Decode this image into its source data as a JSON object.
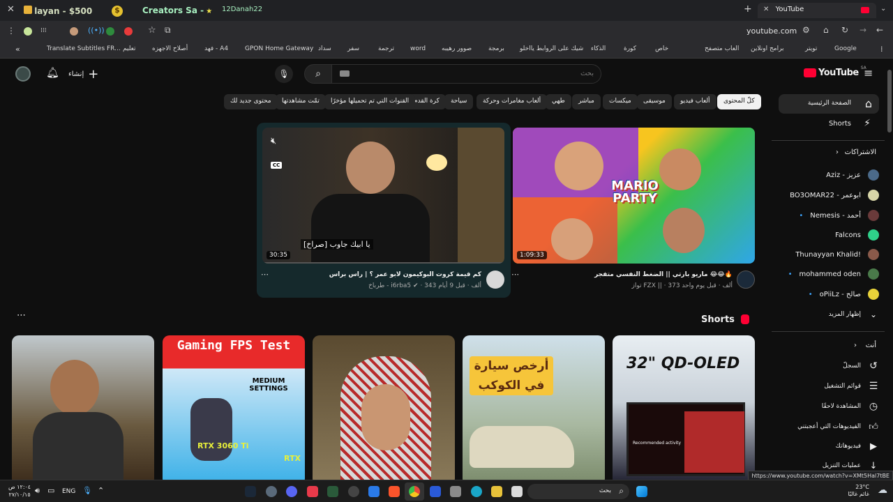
{
  "browser": {
    "tabs": [
      {
        "label": "layan - $500"
      },
      {
        "label": "Creators Sa -"
      },
      {
        "label": "12Danah22"
      }
    ],
    "active_tab": "YouTube",
    "url": "youtube.com",
    "bookmarks": [
      "Google",
      "تويتر",
      "برامج اونلاين",
      "العاب متصفح",
      "خاص",
      "كورة",
      "الذكاء",
      "شيك على الروابط يااخلو",
      "برمجة",
      "صوور رهيبه",
      "word",
      "ترجمة",
      "سفر",
      "سداد",
      "GPON Home Gateway",
      "فهد - A4",
      "أصلاح الاجهزه",
      "تعليم",
      "Translate Subtitles FR..."
    ]
  },
  "youtube": {
    "logo": "YouTube",
    "region": "SA",
    "search_placeholder": "بحث",
    "create_label": "إنشاء",
    "chips": [
      "كلّ المحتوى",
      "ألعاب فيديو",
      "موسيقى",
      "ميكسات",
      "مباشر",
      "طهي",
      "ألعاب مغامرات وحركة",
      "سياحة",
      "كرة القدم",
      "القنوات التي تم تحميلها مؤخرًا",
      "تمّت مشاهدتها",
      "محتوى جديد لك"
    ],
    "sidebar": {
      "home": "الصفحة الرئيسية",
      "shorts": "Shorts",
      "subs_header": "الاشتراكات",
      "subs": [
        "Aziz - عزيز",
        "BO3OMAR22 - ابوعمر",
        "Nemesis - أحمد",
        "Falcons",
        "Thunayyan Khalid!",
        "mohammed oden",
        "oPiiLz - صالح"
      ],
      "show_more": "إظهار المزيد",
      "you_header": "أنت",
      "you_items": [
        "السجلّ",
        "قوائم التشغيل",
        "المشاهدة لاحقًا",
        "الفيديوهات التي أعجبتني",
        "فيديوهاتك",
        "عمليات التنزيل"
      ]
    },
    "videos": [
      {
        "title": "ماريو بارتي || الضغط النفسي متفجر 😂😂🔥",
        "channel": "تواز FZX ||",
        "views": "373 ألف",
        "age": "قبل يوم واحد",
        "duration": "1:09:33",
        "thumb_text": "MARIO PARTY"
      },
      {
        "title": "كم قيمة كروت البوكيمون لابو عمر ؟ | راس براس",
        "channel": "طرباخ - i6rba5",
        "views": "343 ألف",
        "age": "قبل 9 أيام",
        "duration": "30:35",
        "caption": "يا ابيك جاوب [صراخ]",
        "cc": "CC"
      }
    ],
    "shorts_title": "Shorts",
    "shorts": [
      {
        "text": ""
      },
      {
        "text": "Gaming FPS Test",
        "sub": "MEDIUM SETTINGS",
        "gpu": "RTX 3060 Ti",
        "gpu2": "RTX"
      },
      {
        "text": ""
      },
      {
        "text": "أرخص سيارة في الكوكب"
      },
      {
        "text": "32\" QD-OLED",
        "screen_text": "Recommended activity"
      }
    ]
  },
  "status_url": "https://www.youtube.com/watch?v=XMt5Hal7tBE",
  "taskbar": {
    "search": "بحث",
    "lang": "ENG",
    "time": "١٢:٠٤ ص",
    "date": "٢٧/١٠/١٥",
    "weather_temp": "23°C",
    "weather_desc": "غائم غالبًا"
  }
}
